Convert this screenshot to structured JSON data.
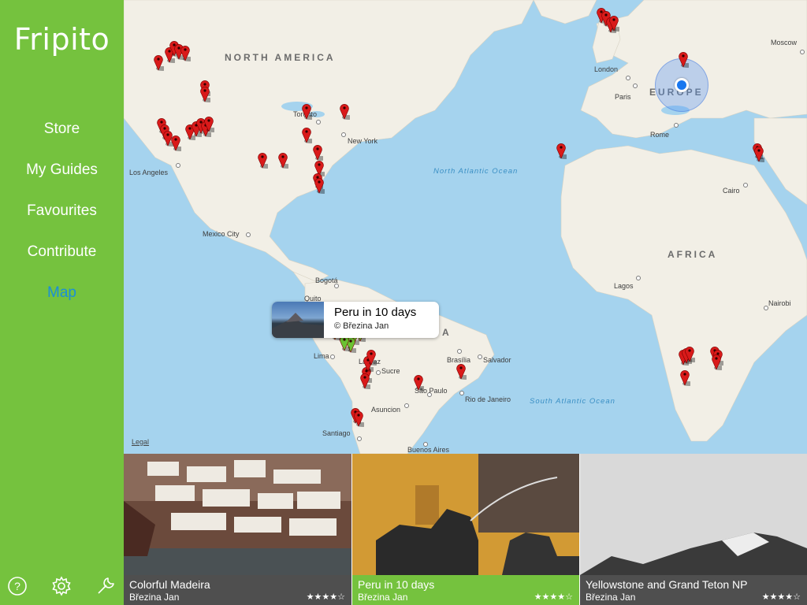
{
  "app": {
    "title": "Fripito"
  },
  "nav": {
    "items": [
      {
        "label": "Store"
      },
      {
        "label": "My Guides"
      },
      {
        "label": "Favourites"
      },
      {
        "label": "Contribute"
      },
      {
        "label": "Map"
      }
    ],
    "active": "Map"
  },
  "footer_icons": [
    "help-icon",
    "settings-gear-icon",
    "wrench-icon"
  ],
  "map": {
    "continents": [
      "NORTH AMERICA",
      "EUROPE",
      "AFRICA",
      "A"
    ],
    "oceans": [
      "North Atlantic Ocean",
      "South Atlantic Ocean"
    ],
    "cities": [
      "Moscow",
      "London",
      "Paris",
      "Rome",
      "Cairo",
      "Lagos",
      "Nairobi",
      "Toronto",
      "New York",
      "Los Angeles",
      "Mexico City",
      "Bogotá",
      "Quito",
      "Lima",
      "La Paz",
      "Sucre",
      "Brasília",
      "Salvador",
      "São Paulo",
      "Rio de Janeiro",
      "Asuncion",
      "Santiago",
      "Buenos Aires"
    ],
    "legal_link": "Legal",
    "pin_color": "#d91a1a",
    "selected_pin_color": "#6bc233",
    "callout": {
      "title": "Peru in 10 days",
      "author": "© Březina Jan"
    }
  },
  "guides": [
    {
      "title": "Colorful Madeira",
      "author": "Březina Jan",
      "rating_text": "★★★★☆"
    },
    {
      "title": "Peru in 10 days",
      "author": "Březina Jan",
      "rating_text": "★★★★☆"
    },
    {
      "title": "Yellowstone and Grand Teton NP",
      "author": "Březina Jan",
      "rating_text": "★★★★☆"
    }
  ],
  "colors": {
    "accent_green": "#75c23e",
    "active_nav": "#1a8fd8",
    "water": "#a5d3ee",
    "land": "#f2efe6"
  }
}
